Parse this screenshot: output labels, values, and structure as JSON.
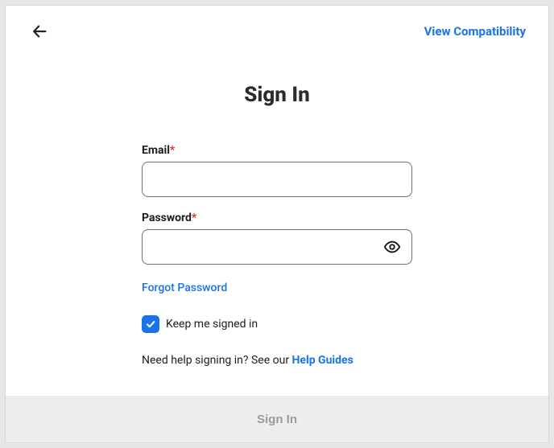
{
  "topbar": {
    "compat_link": "View Compatibility"
  },
  "page": {
    "title": "Sign In"
  },
  "form": {
    "email_label": "Email",
    "email_required_marker": "*",
    "email_value": "",
    "password_label": "Password",
    "password_required_marker": "*",
    "password_value": "",
    "forgot_password": "Forgot Password",
    "keep_signed_in_label": "Keep me signed in",
    "keep_signed_in_checked": true,
    "help_text_prefix": "Need help signing in? See our ",
    "help_link_text": "Help Guides"
  },
  "footer": {
    "submit_label": "Sign In"
  }
}
